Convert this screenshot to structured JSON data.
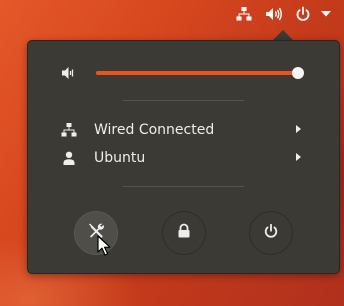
{
  "topbar": {
    "icons": [
      "network-wired-icon",
      "volume-high-icon",
      "power-icon",
      "menu-arrow-down-icon"
    ]
  },
  "volume": {
    "icon": "volume-icon",
    "level": 0.98
  },
  "menu": {
    "items": [
      {
        "label": "Wired Connected",
        "icon": "network-wired-icon"
      },
      {
        "label": "Ubuntu",
        "icon": "user-icon"
      }
    ],
    "actions": [
      {
        "icon": "settings-icon"
      },
      {
        "icon": "lock-icon"
      },
      {
        "icon": "power-off-icon"
      }
    ]
  },
  "colors": {
    "accent": "#e95420",
    "menu_background": "#3b3a35",
    "text": "#eeeeec"
  }
}
